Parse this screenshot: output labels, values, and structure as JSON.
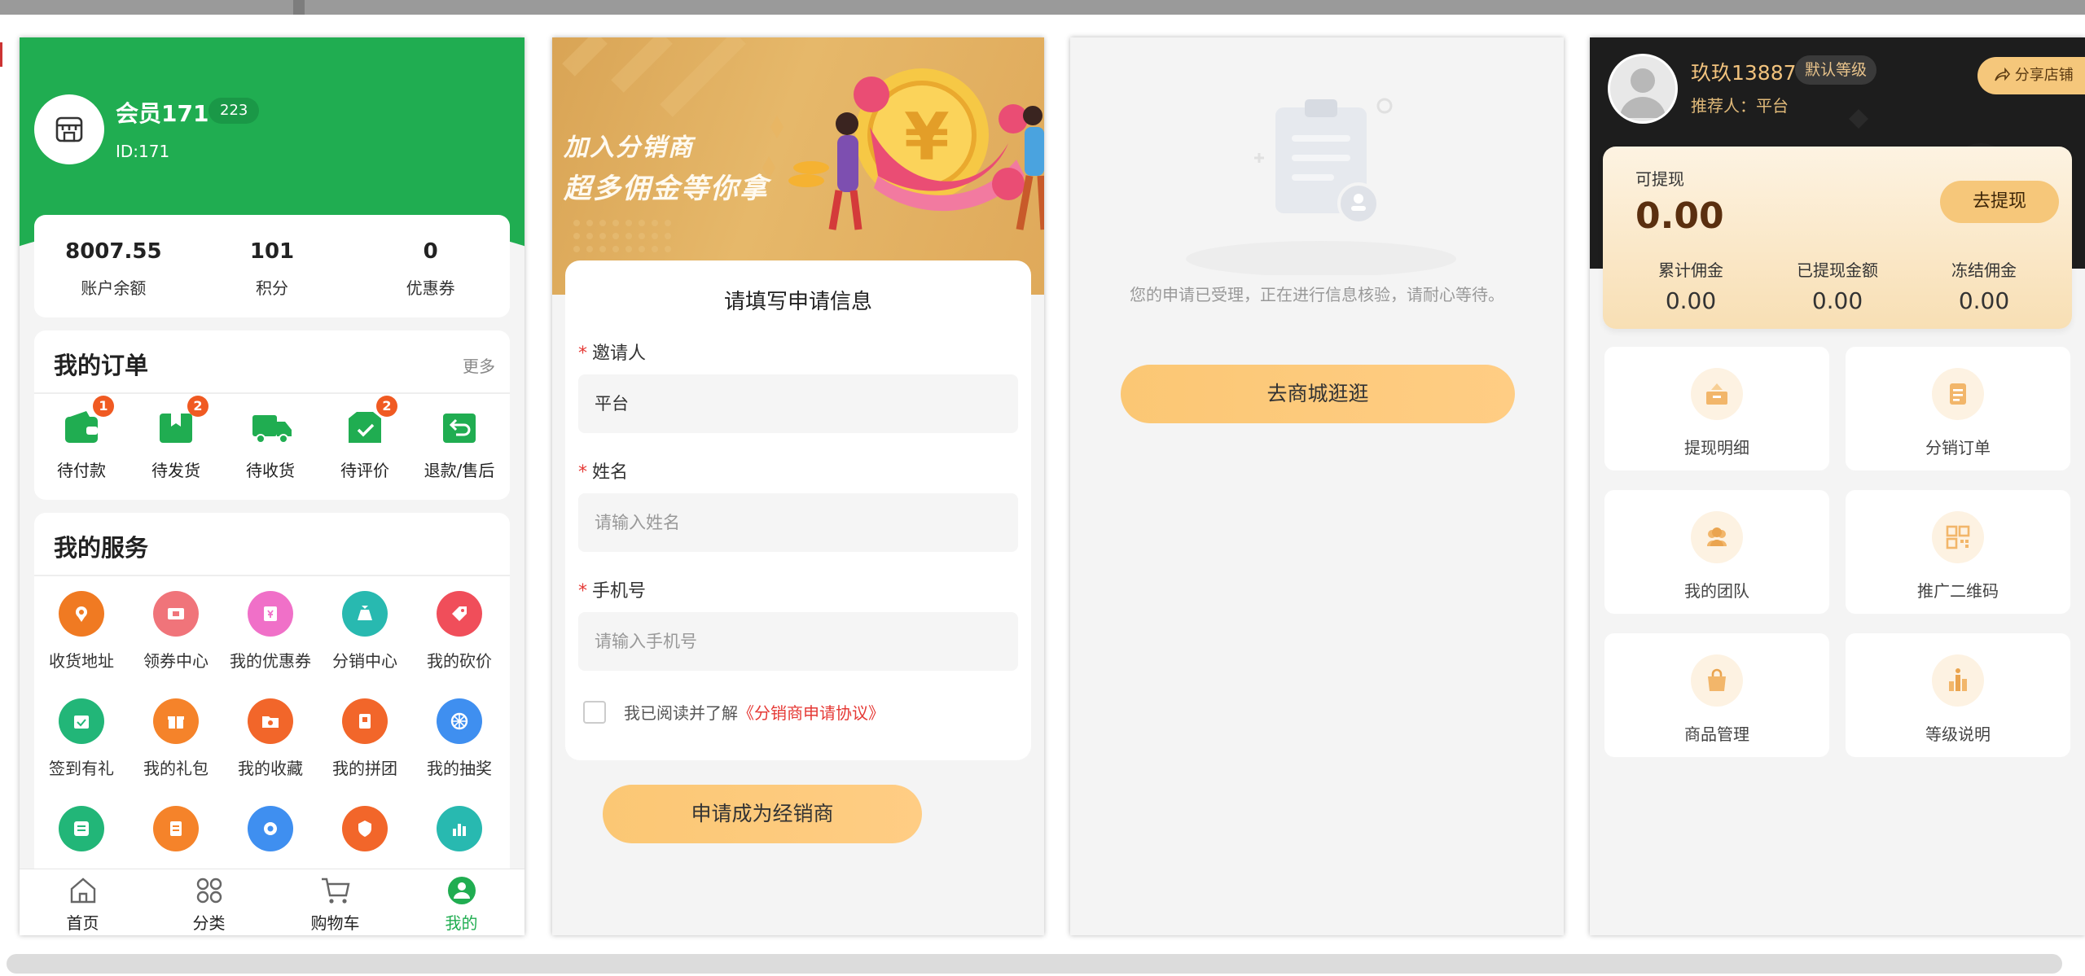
{
  "screen1": {
    "member_name": "会员171",
    "member_badge": "223",
    "member_id": "ID:171",
    "stats": [
      {
        "value": "8007.55",
        "label": "账户余额"
      },
      {
        "value": "101",
        "label": "积分"
      },
      {
        "value": "0",
        "label": "优惠券"
      }
    ],
    "orders": {
      "title": "我的订单",
      "more": "更多",
      "items": [
        {
          "label": "待付款",
          "badge": "1",
          "icon": "wallet-icon"
        },
        {
          "label": "待发货",
          "badge": "2",
          "icon": "package-icon"
        },
        {
          "label": "待收货",
          "badge": "",
          "icon": "truck-icon"
        },
        {
          "label": "待评价",
          "badge": "2",
          "icon": "review-icon"
        },
        {
          "label": "退款/售后",
          "badge": "",
          "icon": "refund-icon"
        }
      ]
    },
    "services": {
      "title": "我的服务",
      "items": [
        {
          "label": "收货地址",
          "color": "#f07a22",
          "icon": "location-icon"
        },
        {
          "label": "领券中心",
          "color": "#f0747a",
          "icon": "coupon-icon"
        },
        {
          "label": "我的优惠券",
          "color": "#f070c8",
          "icon": "ticket-icon"
        },
        {
          "label": "分销中心",
          "color": "#28b9b0",
          "icon": "money-bag-icon"
        },
        {
          "label": "我的砍价",
          "color": "#f04e5a",
          "icon": "tag-icon"
        },
        {
          "label": "签到有礼",
          "color": "#22b678",
          "icon": "calendar-check-icon"
        },
        {
          "label": "我的礼包",
          "color": "#f5832a",
          "icon": "gift-icon"
        },
        {
          "label": "我的收藏",
          "color": "#f2662a",
          "icon": "folder-star-icon"
        },
        {
          "label": "我的拼团",
          "color": "#f2662a",
          "icon": "group-buy-icon"
        },
        {
          "label": "我的抽奖",
          "color": "#3f8ff0",
          "icon": "lottery-wheel-icon"
        },
        {
          "label": "",
          "color": "#22b678",
          "icon": "list-icon"
        },
        {
          "label": "",
          "color": "#f5832a",
          "icon": "clipboard-icon"
        },
        {
          "label": "",
          "color": "#3f8ff0",
          "icon": "settings-icon"
        },
        {
          "label": "",
          "color": "#f2662a",
          "icon": "shield-icon"
        },
        {
          "label": "",
          "color": "#28b9b0",
          "icon": "chart-icon"
        }
      ]
    },
    "tabbar": [
      {
        "label": "首页",
        "icon": "home-icon"
      },
      {
        "label": "分类",
        "icon": "category-icon"
      },
      {
        "label": "购物车",
        "icon": "cart-icon"
      },
      {
        "label": "我的",
        "icon": "user-icon",
        "active": true
      }
    ]
  },
  "screen2": {
    "banner_line1": "加入分销商",
    "banner_line2": "超多佣金等你拿",
    "form_title": "请填写申请信息",
    "inviter_label": "邀请人",
    "inviter_value": "平台",
    "name_label": "姓名",
    "name_placeholder": "请输入姓名",
    "phone_label": "手机号",
    "phone_placeholder": "请输入手机号",
    "agree_text": "我已阅读并了解",
    "agree_link": "《分销商申请协议》",
    "submit_label": "申请成为经销商"
  },
  "screen3": {
    "pending_text": "您的申请已受理，正在进行信息核验，请耐心等待。",
    "go_mall_label": "去商城逛逛"
  },
  "screen4": {
    "user_name": "玖玖13887",
    "level": "默认等级",
    "referrer": "推荐人：平台",
    "share_label": "分享店铺",
    "withdrawable_label": "可提现",
    "withdrawable_amount": "0.00",
    "withdraw_button": "去提现",
    "summary": [
      {
        "label": "累计佣金",
        "value": "0.00"
      },
      {
        "label": "已提现金额",
        "value": "0.00"
      },
      {
        "label": "冻结佣金",
        "value": "0.00"
      }
    ],
    "menu": [
      {
        "label": "提现明细",
        "icon": "withdraw-record-icon"
      },
      {
        "label": "分销订单",
        "icon": "order-list-icon"
      },
      {
        "label": "我的团队",
        "icon": "team-icon"
      },
      {
        "label": "推广二维码",
        "icon": "qr-code-icon"
      },
      {
        "label": "商品管理",
        "icon": "shopping-bag-icon"
      },
      {
        "label": "等级说明",
        "icon": "level-chart-icon"
      }
    ]
  }
}
